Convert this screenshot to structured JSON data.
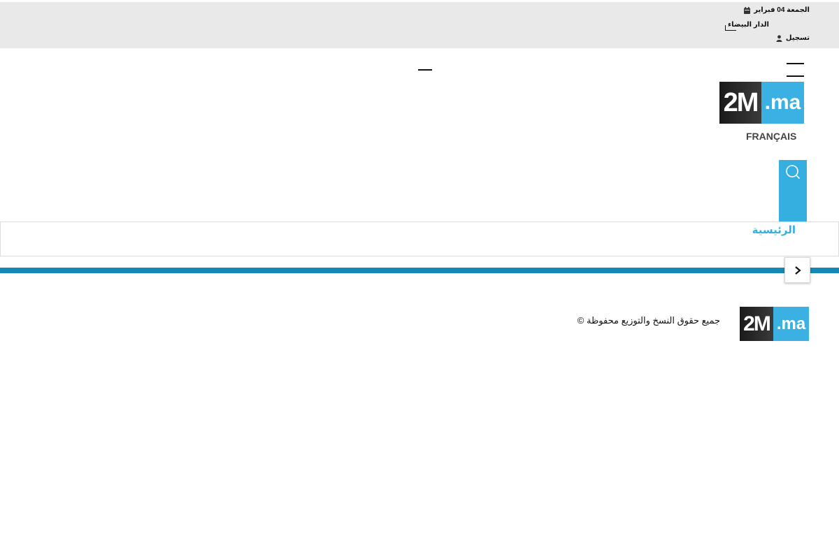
{
  "topbar": {
    "date": "الجمعة 04 فبراير",
    "city": "الدار البيضاء",
    "register": "تسجيل",
    "calendar_icon": "calendar-icon",
    "user_icon": "user-icon"
  },
  "header": {
    "logo": {
      "dark": "2M",
      "blue": ".ma"
    },
    "language_link": "FRANÇAIS",
    "search_icon": "search-icon",
    "menu_icon": "hamburger-menu-icon"
  },
  "nav": {
    "items": [
      {
        "label": "الرئيسية"
      }
    ],
    "scroll_icon": "chevron-right-icon"
  },
  "footer": {
    "logo": {
      "dark": "2M",
      "blue": ".ma"
    },
    "copyright": "جميع حقوق النسخ والتوزيع محفوظة ©"
  },
  "colors": {
    "topbar_bg": "#e9e9e9",
    "accent": "#34afe0",
    "rule": "#1389b7"
  }
}
